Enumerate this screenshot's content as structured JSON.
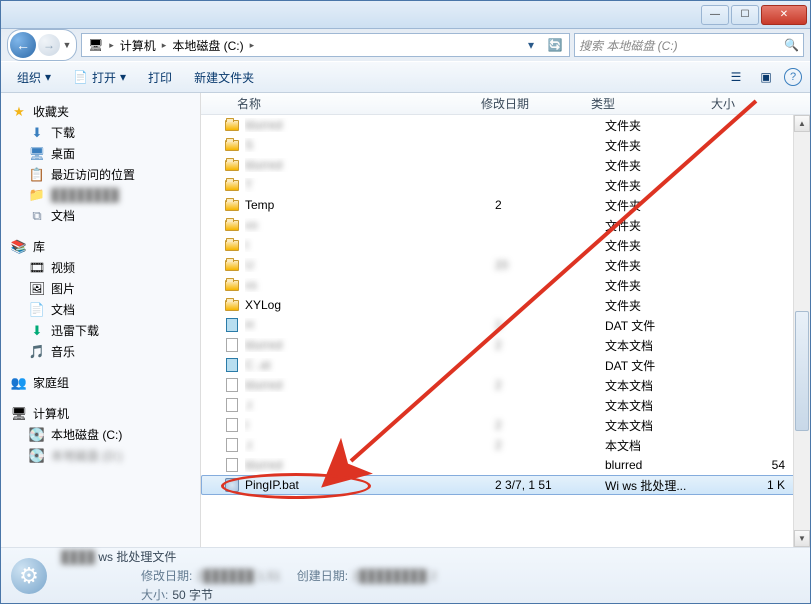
{
  "titlebar": {
    "min": "—",
    "max": "☐",
    "close": "✕"
  },
  "nav": {
    "back": "←",
    "fwd": "→",
    "drop": "▼"
  },
  "breadcrumb": {
    "root_icon": "🖥",
    "items": [
      "计算机",
      "本地磁盘 (C:)"
    ],
    "sep": "▸",
    "refresh": "🔄",
    "dropdown": "▾"
  },
  "search": {
    "placeholder": "搜索 本地磁盘 (C:)",
    "icon": "🔍"
  },
  "toolbar": {
    "organize": "组织",
    "open": "打开",
    "open_icon": "📄",
    "print": "打印",
    "newfolder": "新建文件夹",
    "view_icon": "☰",
    "layout_icon": "▣",
    "help_icon": "?"
  },
  "sidebar": {
    "favorites": {
      "label": "收藏夹",
      "icon": "★"
    },
    "fav_items": [
      {
        "label": "下载",
        "icon": "⬇"
      },
      {
        "label": "桌面",
        "icon": "🖥"
      },
      {
        "label": "最近访问的位置",
        "icon": "📋"
      },
      {
        "label": "blurred",
        "icon": "📁",
        "blur": true
      },
      {
        "label": "文档",
        "icon": "⧉"
      }
    ],
    "libraries": {
      "label": "库",
      "icon": "📚"
    },
    "lib_items": [
      {
        "label": "视频",
        "icon": "🎞"
      },
      {
        "label": "图片",
        "icon": "🖼"
      },
      {
        "label": "文档",
        "icon": "📄"
      },
      {
        "label": "迅雷下载",
        "icon": "⬇"
      },
      {
        "label": "音乐",
        "icon": "🎵"
      }
    ],
    "homegroup": {
      "label": "家庭组",
      "icon": "👥"
    },
    "computer": {
      "label": "计算机",
      "icon": "🖥"
    },
    "comp_items": [
      {
        "label": "本地磁盘 (C:)",
        "icon": "💽"
      },
      {
        "label": "本地磁盘 (D:)",
        "icon": "💽",
        "blur": true
      }
    ]
  },
  "columns": {
    "name": "名称",
    "date": "修改日期",
    "type": "类型",
    "size": "大小"
  },
  "files": [
    {
      "name": "blurred",
      "type": "文件夹",
      "kind": "folder",
      "blur": true
    },
    {
      "name": "S",
      "type": "文件夹",
      "kind": "folder",
      "blur": true
    },
    {
      "name": "blurred",
      "type": "文件夹",
      "kind": "folder",
      "blur": true
    },
    {
      "name": "T",
      "type": "文件夹",
      "kind": "folder",
      "blur": true
    },
    {
      "name": "Temp",
      "date": "2",
      "type": "文件夹",
      "kind": "folder"
    },
    {
      "name": "     vo",
      "type": "文件夹",
      "kind": "folder",
      "blur": true
    },
    {
      "name": "   t",
      "type": "文件夹",
      "kind": "folder",
      "blur": true
    },
    {
      "name": "U",
      "date": "20",
      "type": "文件夹",
      "kind": "folder",
      "blur": true
    },
    {
      "name": "     vs",
      "type": "文件夹",
      "kind": "folder",
      "blur": true
    },
    {
      "name": "XYLog",
      "type": "文件夹",
      "kind": "folder"
    },
    {
      "name": "H",
      "date": "2",
      "type": "DAT 文件",
      "kind": "dat",
      "blur": true
    },
    {
      "name": "blurred",
      "date": "2",
      "type": "文本文档",
      "kind": "file",
      "blur": true
    },
    {
      "name": "C            .at",
      "date": "",
      "type": "DAT 文件",
      "kind": "dat",
      "blur": true
    },
    {
      "name": "blurred",
      "date": "2",
      "type": "文本文档",
      "kind": "file",
      "blur": true
    },
    {
      "name": "        .t",
      "type": "文本文档",
      "kind": "file",
      "blur": true
    },
    {
      "name": "I",
      "date": "2",
      "type": "文本文档",
      "kind": "file",
      "blur": true
    },
    {
      "name": "      .t",
      "date": "2",
      "type": "本文档",
      "kind": "file",
      "blur": true
    },
    {
      "name": "blurred",
      "type": "blurred",
      "kind": "file",
      "blur": true,
      "size": "54"
    },
    {
      "name": "PingIP.bat",
      "date": "2  3/7,   1  51",
      "type": "Wi    ws 批处理...",
      "kind": "bat",
      "sel": true,
      "size": "1 K"
    },
    {
      "name": "",
      "kind": "spacer"
    }
  ],
  "details": {
    "filename": "PingIP.bat",
    "filetype": "ws 批处理文件",
    "date_label": "修改日期:",
    "date_value": "2            51",
    "created_label": "创建日期:",
    "created_value": "2                2",
    "size_label": "大小:",
    "size_value": "50 字节"
  }
}
